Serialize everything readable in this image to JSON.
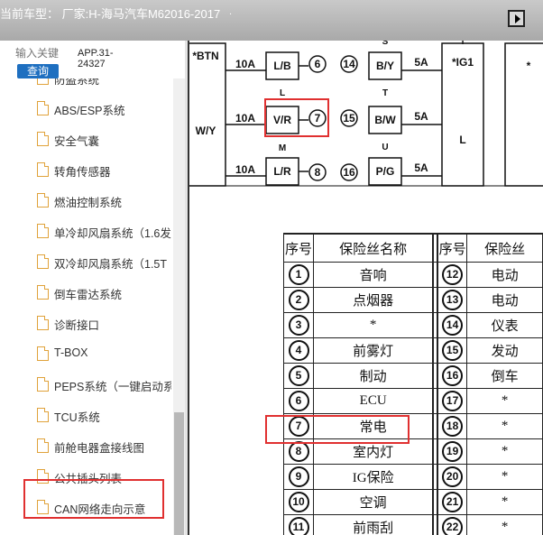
{
  "header": {
    "car_model": "当前车型：  厂家:H-海马汽车M62016-2017",
    "dot": "."
  },
  "search": {
    "placeholder": "输入关键",
    "button_label": "查询",
    "app_code_line1": "APP.31-",
    "app_code_line2": "24327"
  },
  "sidebar": {
    "items": [
      {
        "label": "防盗系统"
      },
      {
        "label": "ABS/ESP系统"
      },
      {
        "label": "安全气囊"
      },
      {
        "label": "转角传感器"
      },
      {
        "label": "燃油控制系统"
      },
      {
        "label": "单冷却风扇系统（1.6发"
      },
      {
        "label": "双冷却风扇系统（1.5T"
      },
      {
        "label": "倒车雷达系统"
      },
      {
        "label": "诊断接口"
      },
      {
        "label": "T-BOX"
      },
      {
        "label": "PEPS系统（一键启动系"
      },
      {
        "label": "TCU系统"
      },
      {
        "label": "前舱电器盒接线图"
      },
      {
        "label": "公共插头列表"
      },
      {
        "label": "CAN网络走向示意"
      }
    ]
  },
  "diagram": {
    "btn_label": "*BTN",
    "wy_label": "W/Y",
    "amp_1": "10A",
    "amp_2": "10A",
    "amp_3": "10A",
    "conn_1": "L/B",
    "conn_2": "V/R",
    "conn_3": "L/R",
    "letter_l": "L",
    "letter_m": "M",
    "num_6": "6",
    "num_7": "7",
    "num_8": "8",
    "num_14": "14",
    "num_15": "15",
    "num_16": "16",
    "letter_s": "S",
    "letter_t": "T",
    "letter_u": "U",
    "conn_4": "B/Y",
    "conn_5": "B/W",
    "conn_6": "P/G",
    "amp_4": "5A",
    "amp_5": "5A",
    "amp_6": "5A",
    "ig1_label": "*IG1",
    "ig1_l": "L",
    "star": "*",
    "top_s": "S",
    "top_t": "T"
  },
  "fuse_table": {
    "headers": [
      "序号",
      "保险丝名称",
      "序号",
      "保险丝"
    ],
    "rows": [
      {
        "no": "1",
        "name": "音响",
        "no2": "12",
        "name2": "电动"
      },
      {
        "no": "2",
        "name": "点烟器",
        "no2": "13",
        "name2": "电动"
      },
      {
        "no": "3",
        "name": "*",
        "no2": "14",
        "name2": "仪表"
      },
      {
        "no": "4",
        "name": "前雾灯",
        "no2": "15",
        "name2": "发动"
      },
      {
        "no": "5",
        "name": "制动",
        "no2": "16",
        "name2": "倒车"
      },
      {
        "no": "6",
        "name": "ECU",
        "no2": "17",
        "name2": "*"
      },
      {
        "no": "7",
        "name": "常电",
        "no2": "18",
        "name2": "*"
      },
      {
        "no": "8",
        "name": "室内灯",
        "no2": "19",
        "name2": "*"
      },
      {
        "no": "9",
        "name": "IG保险",
        "no2": "20",
        "name2": "*"
      },
      {
        "no": "10",
        "name": "空调",
        "no2": "21",
        "name2": "*"
      },
      {
        "no": "11",
        "name": "前雨刮",
        "no2": "22",
        "name2": "*"
      }
    ]
  }
}
